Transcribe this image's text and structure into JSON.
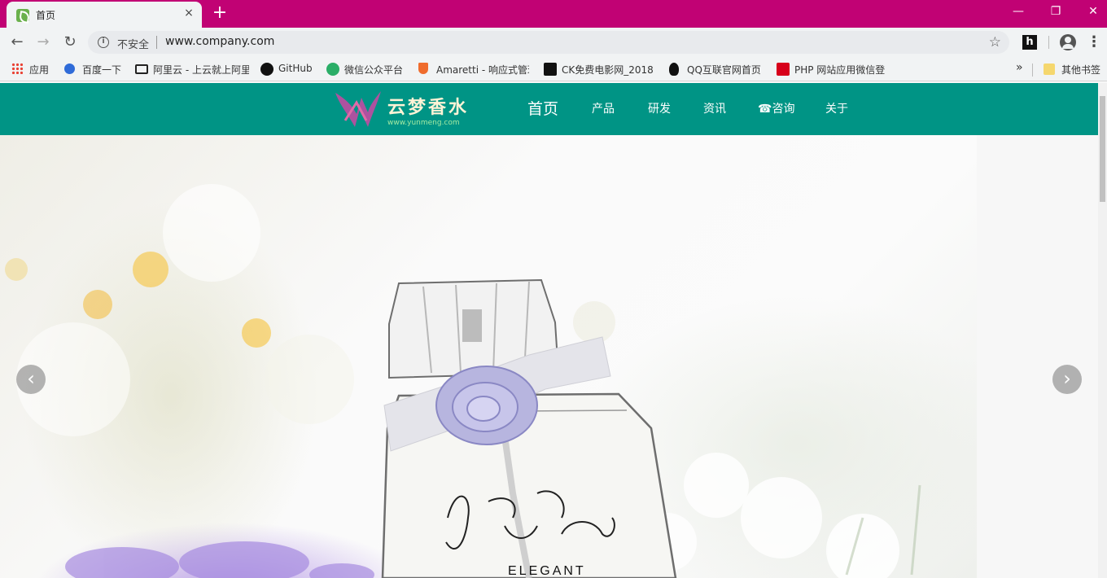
{
  "browser": {
    "tab_title": "首页",
    "tab_close": "×",
    "new_tab": "+",
    "window": {
      "minimize": "—",
      "restore": "❐",
      "close": "✕"
    },
    "nav": {
      "back": "←",
      "forward": "→",
      "reload": "↻"
    },
    "security_label": "不安全",
    "url": "www.company.com",
    "bookmark_star": "☆",
    "ext_label": "h",
    "menu": "⋮"
  },
  "bookmarks": {
    "items": [
      {
        "label": "应用",
        "icon": "apps-grid-icon"
      },
      {
        "label": "百度一下",
        "icon": "baidu-paw-icon",
        "color": "#2f6bd8"
      },
      {
        "label": "阿里云 - 上云就上阿里",
        "icon": "aliyun-icon",
        "color": "#222222"
      },
      {
        "label": "GitHub",
        "icon": "github-icon",
        "color": "#111111"
      },
      {
        "label": "微信公众平台",
        "icon": "wechat-icon",
        "color": "#2aae67"
      },
      {
        "label": "Amaretti - 响应式管理",
        "icon": "amaretti-icon",
        "color": "#ef6c2d"
      },
      {
        "label": "CK免费电影网_2018",
        "icon": "ck-icon",
        "color": "#111111"
      },
      {
        "label": "QQ互联官网首页",
        "icon": "qq-penguin-icon",
        "color": "#111111"
      },
      {
        "label": "PHP 网站应用微信登",
        "icon": "php-c-icon",
        "color": "#d7001a"
      }
    ],
    "more": "»",
    "other_folder": "其他书签"
  },
  "site": {
    "brand": "云梦香水",
    "brand_url": "www.yunmeng.com",
    "nav": [
      "首页",
      "产品",
      "研发",
      "资讯",
      "☎咨询",
      "关于"
    ],
    "header_color": "#009485"
  },
  "carousel": {
    "prev": "‹",
    "next": "›",
    "bottle_text": "ELEGANT"
  }
}
